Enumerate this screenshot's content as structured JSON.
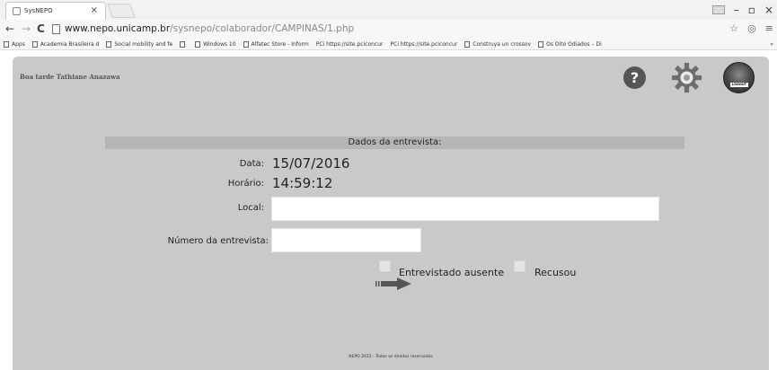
{
  "browser": {
    "tab_title": "SysNEPO",
    "tab_close": "×",
    "window_controls": {
      "minimize": "–",
      "maximize": "▫",
      "close": "×"
    },
    "nav": {
      "back": "←",
      "forward": "→",
      "reload": "C"
    },
    "url_domain": "www.nepo.unicamp.br",
    "url_path": "/sysnepo/colaborador/CAMPINAS/1.php",
    "omnibox_icons": {
      "bookmark": "☆",
      "extension": "◎",
      "menu": "≡"
    },
    "bookmarks": [
      {
        "label": "Apps",
        "icon": "apps-icon"
      },
      {
        "label": "Academia Brasileira d",
        "icon": "page-icon"
      },
      {
        "label": "Social mobility and fe",
        "icon": "page-icon"
      },
      {
        "label": "",
        "icon": "page-icon"
      },
      {
        "label": "Windows 10",
        "icon": "windows-icon"
      },
      {
        "label": "Alfatec Store - Inform",
        "icon": "page-icon"
      },
      {
        "label": "PCi https://site.pciconcur",
        "icon": "pci-icon"
      },
      {
        "label": "PCi https://site.pciconcur",
        "icon": "pci-icon"
      },
      {
        "label": "Construya un crossov",
        "icon": "page-icon"
      },
      {
        "label": "Os Oito Odiados – Di",
        "icon": "film-icon"
      }
    ],
    "bookmarks_overflow": "»"
  },
  "header": {
    "greeting": "Boa tarde Tathiane Anazawa",
    "help_symbol": "?",
    "logout_label": "LOGOUT"
  },
  "form": {
    "section_title": "Dados da entrevista:",
    "date_label": "Data:",
    "date_value": "15/07/2016",
    "time_label": "Horário:",
    "time_value": "14:59:12",
    "location_label": "Local:",
    "location_value": "",
    "interview_number_label": "Número da entrevista:",
    "interview_number_value": "",
    "absent_label": "Entrevistado ausente",
    "refused_label": "Recusou"
  },
  "footer": {
    "text": "NEPO 2015 - Todos os direitos reservados"
  }
}
